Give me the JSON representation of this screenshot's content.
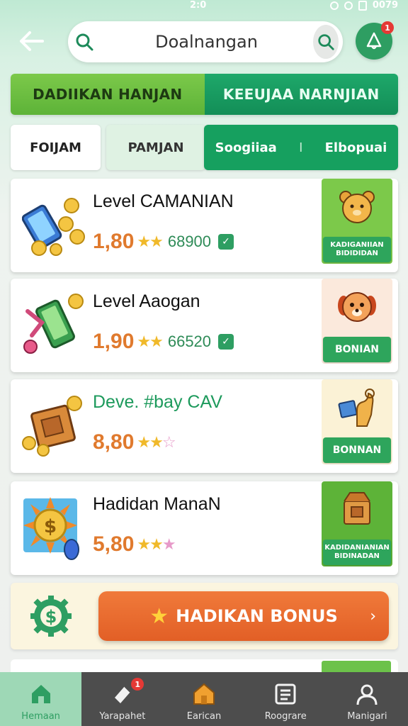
{
  "status_bar": {
    "center_text": "2:0",
    "right_text": "0079"
  },
  "header": {
    "search_value": "Doalnangan",
    "notification_count": "1"
  },
  "top_tabs": [
    {
      "label": "DADIIKAN HANJAN"
    },
    {
      "label": "KEEUJAA NARNJIAN"
    }
  ],
  "filters": {
    "chip_1": "FOIJAM",
    "chip_2": "PAMJAN",
    "chip_3a": "Soogiiaa",
    "chip_3_sep": "I",
    "chip_3b": "Elbopuai"
  },
  "cards": [
    {
      "title": "Level CAMANIAN",
      "rating": "1,80",
      "reviews": "68900",
      "side_button": "KADIGANIIAN BIDIDIDAN",
      "icon": "phone-coins-icon",
      "side_icon": "bear-icon"
    },
    {
      "title": "Level Aaogan",
      "rating": "1,90",
      "reviews": "66520",
      "side_button": "BONIAN",
      "icon": "phone-tap-icon",
      "side_icon": "dog-icon"
    },
    {
      "title": "Deve. #bay CAV",
      "rating": "8,80",
      "side_button": "BONNAN",
      "icon": "box-coins-icon",
      "side_icon": "hand-card-icon"
    },
    {
      "title": "Hadidan ManaN",
      "rating": "5,80",
      "side_button": "KADIDANIANIAN BIDINADAN",
      "icon": "sun-coin-icon",
      "side_icon": "treasure-box-icon"
    }
  ],
  "bonus": {
    "label": "HADIKAN BONUS",
    "chevron": "›"
  },
  "bottom_nav": [
    {
      "label": "Hemaan",
      "icon": "home-icon",
      "active": true
    },
    {
      "label": "Yarapahet",
      "icon": "ticket-icon",
      "badge": "1"
    },
    {
      "label": "Earican",
      "icon": "house-icon"
    },
    {
      "label": "Roograre",
      "icon": "list-icon"
    },
    {
      "label": "Manigari",
      "icon": "user-icon"
    }
  ],
  "colors": {
    "primary_green": "#16a05f",
    "light_green": "#7cc94a",
    "accent_orange": "#e25f26",
    "rating_orange": "#e07a2e",
    "star_gold": "#f0b92a"
  }
}
